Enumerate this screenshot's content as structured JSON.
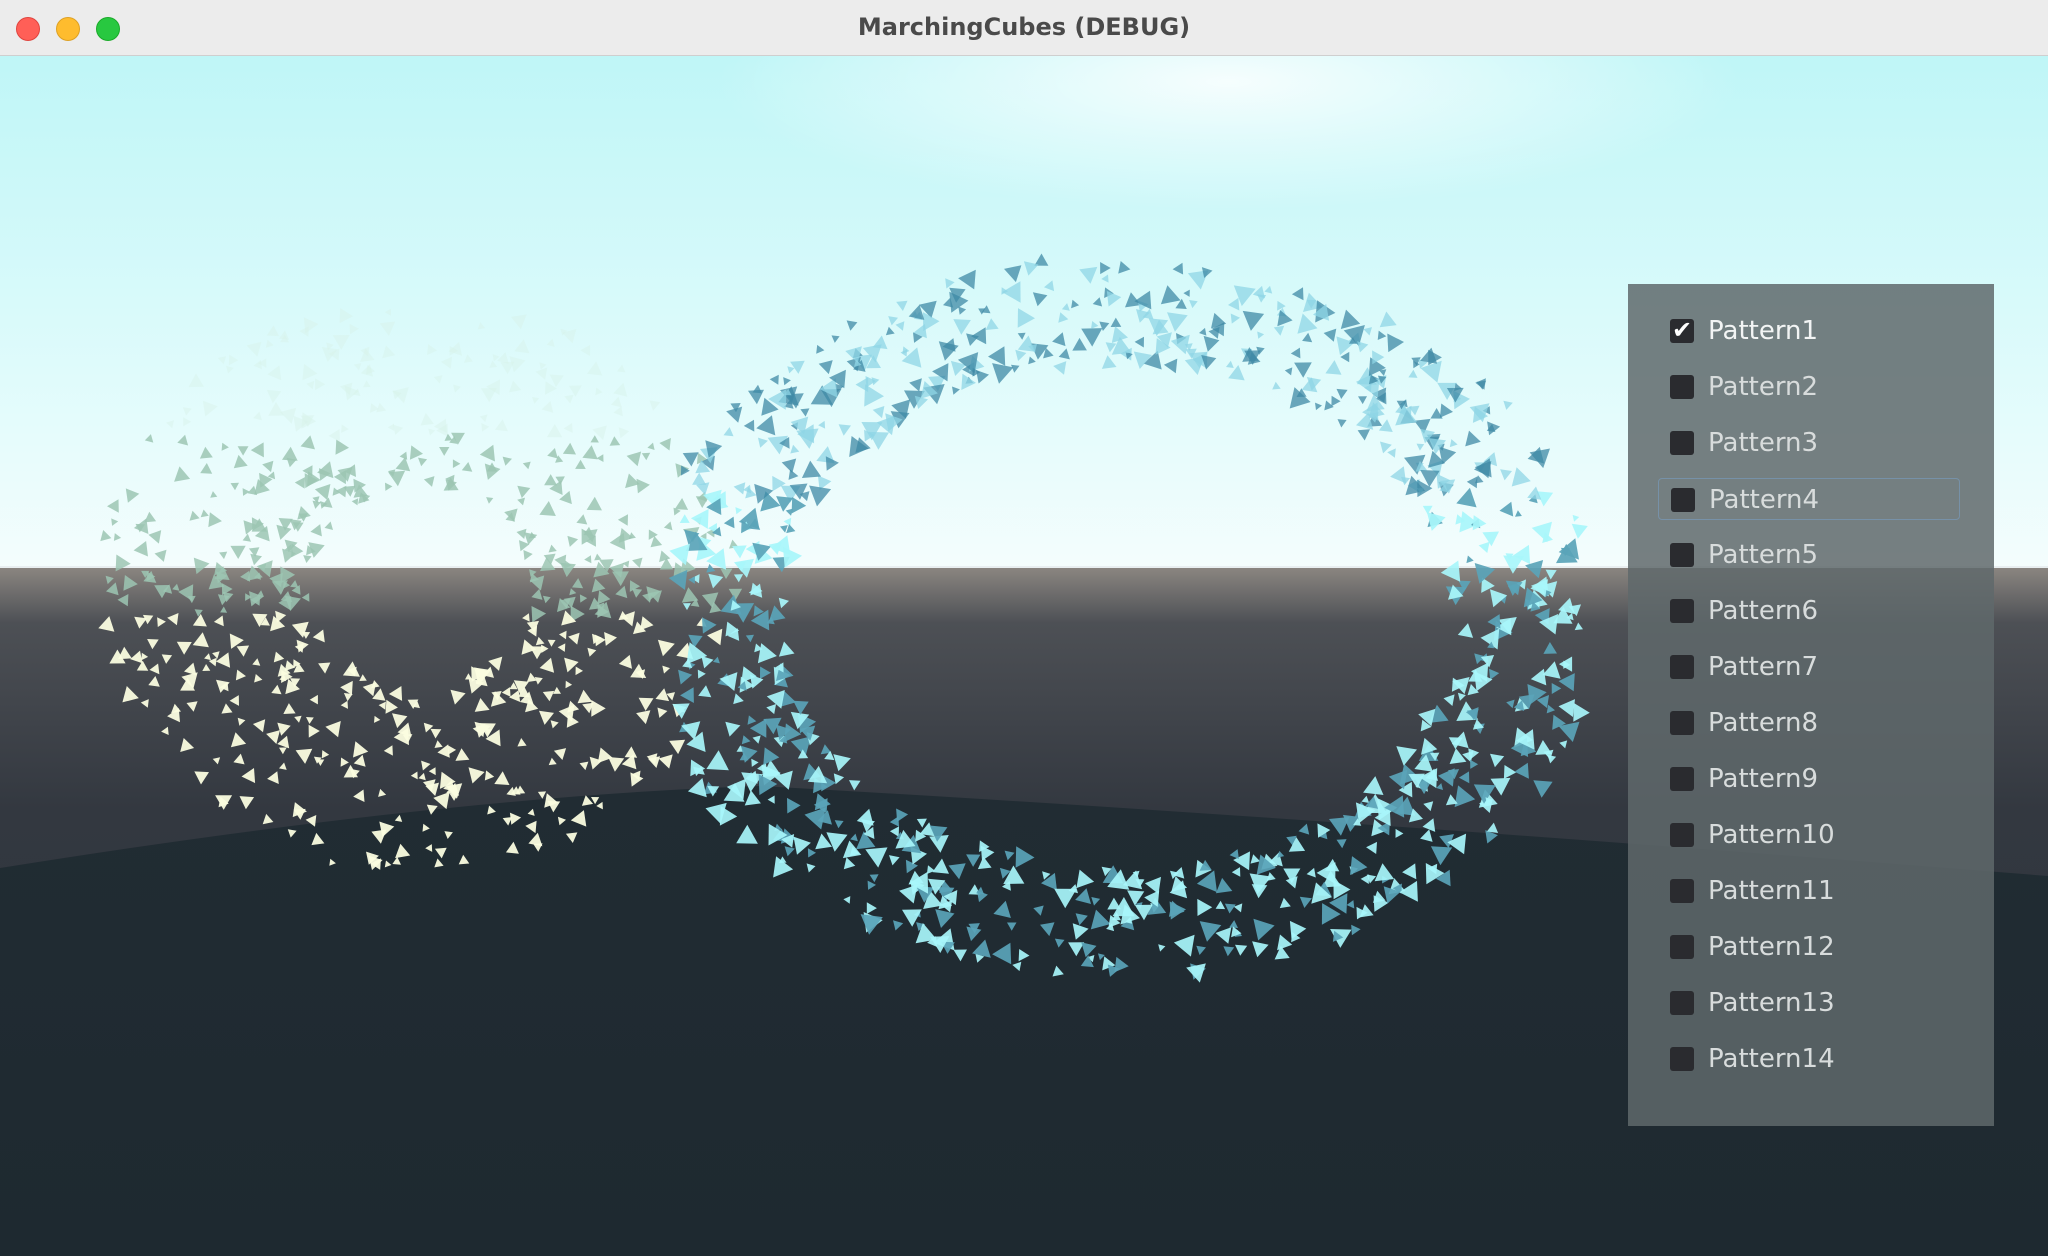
{
  "window": {
    "title": "MarchingCubes (DEBUG)"
  },
  "icons": {
    "close": "close-button",
    "minimize": "minimize-button",
    "zoom": "zoom-button",
    "checkmark": "✔"
  },
  "colors": {
    "sky_top": "#bff6f7",
    "sky_horizon": "#f1fdfd",
    "ground": "#202a31",
    "sphere_mesh": "#fbfde0",
    "torus_mesh": "#9ef3f8",
    "panel_bg": "#5f686b"
  },
  "patterns": [
    {
      "label": "Pattern1",
      "checked": true
    },
    {
      "label": "Pattern2",
      "checked": false
    },
    {
      "label": "Pattern3",
      "checked": false
    },
    {
      "label": "Pattern4",
      "checked": false,
      "focused": true
    },
    {
      "label": "Pattern5",
      "checked": false
    },
    {
      "label": "Pattern6",
      "checked": false
    },
    {
      "label": "Pattern7",
      "checked": false
    },
    {
      "label": "Pattern8",
      "checked": false
    },
    {
      "label": "Pattern9",
      "checked": false
    },
    {
      "label": "Pattern10",
      "checked": false
    },
    {
      "label": "Pattern11",
      "checked": false
    },
    {
      "label": "Pattern12",
      "checked": false
    },
    {
      "label": "Pattern13",
      "checked": false
    },
    {
      "label": "Pattern14",
      "checked": false
    }
  ]
}
